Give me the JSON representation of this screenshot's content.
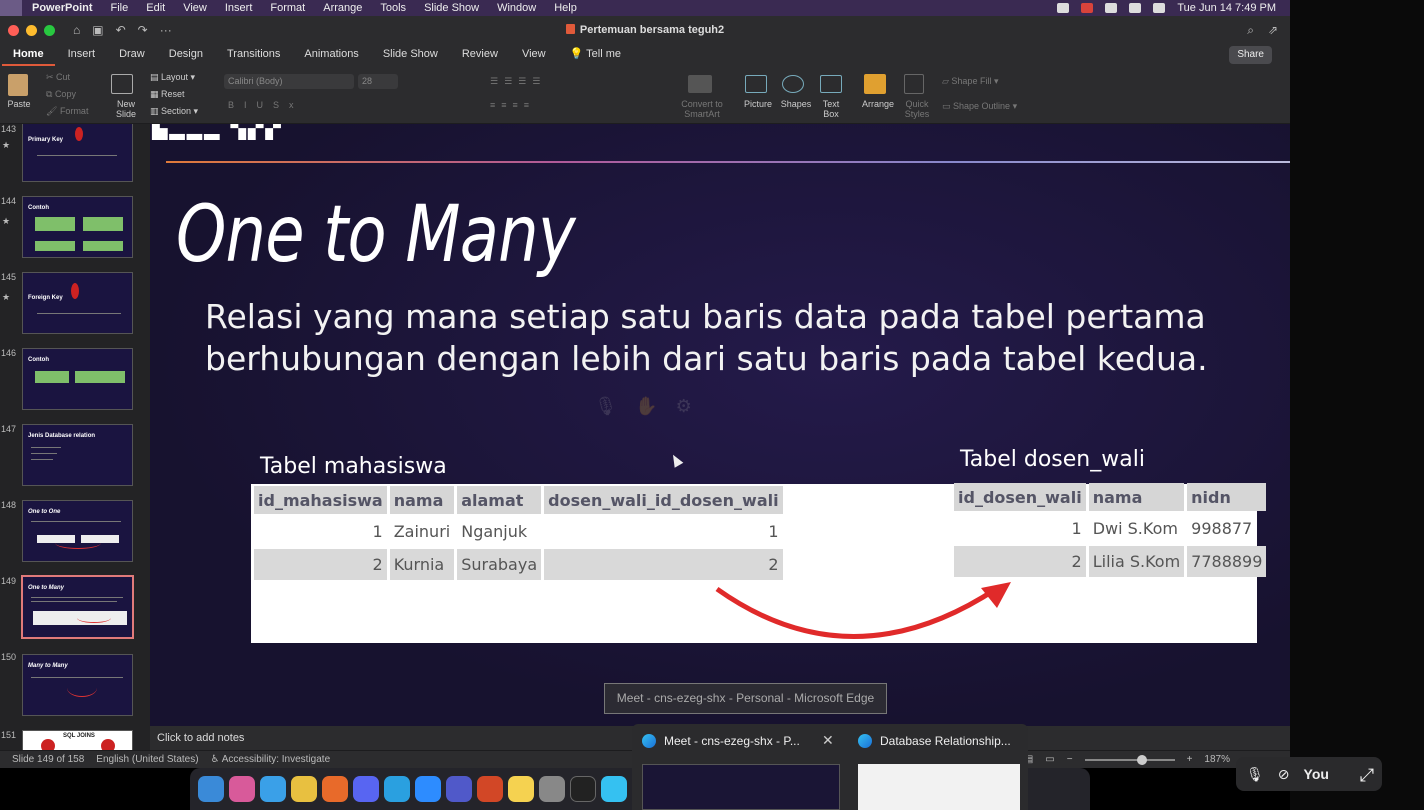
{
  "menubar": {
    "app": "PowerPoint",
    "items": [
      "File",
      "Edit",
      "View",
      "Insert",
      "Format",
      "Arrange",
      "Tools",
      "Slide Show",
      "Window",
      "Help"
    ],
    "clock": "Tue Jun 14  7:49 PM"
  },
  "window": {
    "title": "Pertemuan bersama teguh2"
  },
  "ribbon_tabs": [
    "Home",
    "Insert",
    "Draw",
    "Design",
    "Transitions",
    "Animations",
    "Slide Show",
    "Review",
    "View"
  ],
  "tell_me": "Tell me",
  "share": "Share",
  "ribbon": {
    "paste": "Paste",
    "cut": "Cut",
    "copy": "Copy",
    "format": "Format",
    "new_slide": "New Slide",
    "layout": "Layout",
    "reset": "Reset",
    "section": "Section",
    "font": "Calibri (Body)",
    "size": "28",
    "convert": "Convert to SmartArt",
    "picture": "Picture",
    "shapes": "Shapes",
    "text_box": "Text Box",
    "arrange": "Arrange",
    "quick_styles": "Quick Styles",
    "shape_fill": "Shape Fill",
    "shape_outline": "Shape Outline"
  },
  "thumbnails": [
    {
      "num": "143",
      "title": "Primary Key"
    },
    {
      "num": "144",
      "title": "Contoh"
    },
    {
      "num": "145",
      "title": "Foreign Key"
    },
    {
      "num": "146",
      "title": "Contoh"
    },
    {
      "num": "147",
      "title": "Jenis Database relation"
    },
    {
      "num": "148",
      "title": "One to One"
    },
    {
      "num": "149",
      "title": "One to Many"
    },
    {
      "num": "150",
      "title": "Many to Many"
    },
    {
      "num": "151",
      "title": "SQL JOINS"
    }
  ],
  "slide": {
    "title": "One to Many",
    "body_line1": "Relasi yang mana setiap satu baris data pada tabel pertama",
    "body_line2": "berhubungan dengan lebih dari satu baris pada tabel kedua.",
    "left_label": "Tabel mahasiswa",
    "right_label": "Tabel dosen_wali",
    "mahasiswa": {
      "headers": [
        "id_mahasiswa",
        "nama",
        "alamat",
        "dosen_wali_id_dosen_wali"
      ],
      "rows": [
        [
          "1",
          "Zainuri",
          "Nganjuk",
          "1"
        ],
        [
          "2",
          "Kurnia",
          "Surabaya",
          "2"
        ]
      ]
    },
    "dosen_wali": {
      "headers": [
        "id_dosen_wali",
        "nama",
        "nidn"
      ],
      "rows": [
        [
          "1",
          "Dwi S.Kom",
          "998877"
        ],
        [
          "2",
          "Lilia S.Kom",
          "7788899"
        ]
      ]
    }
  },
  "tooltip": "Meet - cns-ezeg-shx - Personal - Microsoft Edge",
  "notes": "Click to add notes",
  "status": {
    "slide": "Slide 149 of 158",
    "language": "English (United States)",
    "accessibility": "Accessibility: Investigate",
    "zoom": "187%"
  },
  "previews": [
    {
      "title": "Meet - cns-ezeg-shx - P..."
    },
    {
      "title": "Database Relationship..."
    }
  ],
  "meet": {
    "you": "You"
  }
}
